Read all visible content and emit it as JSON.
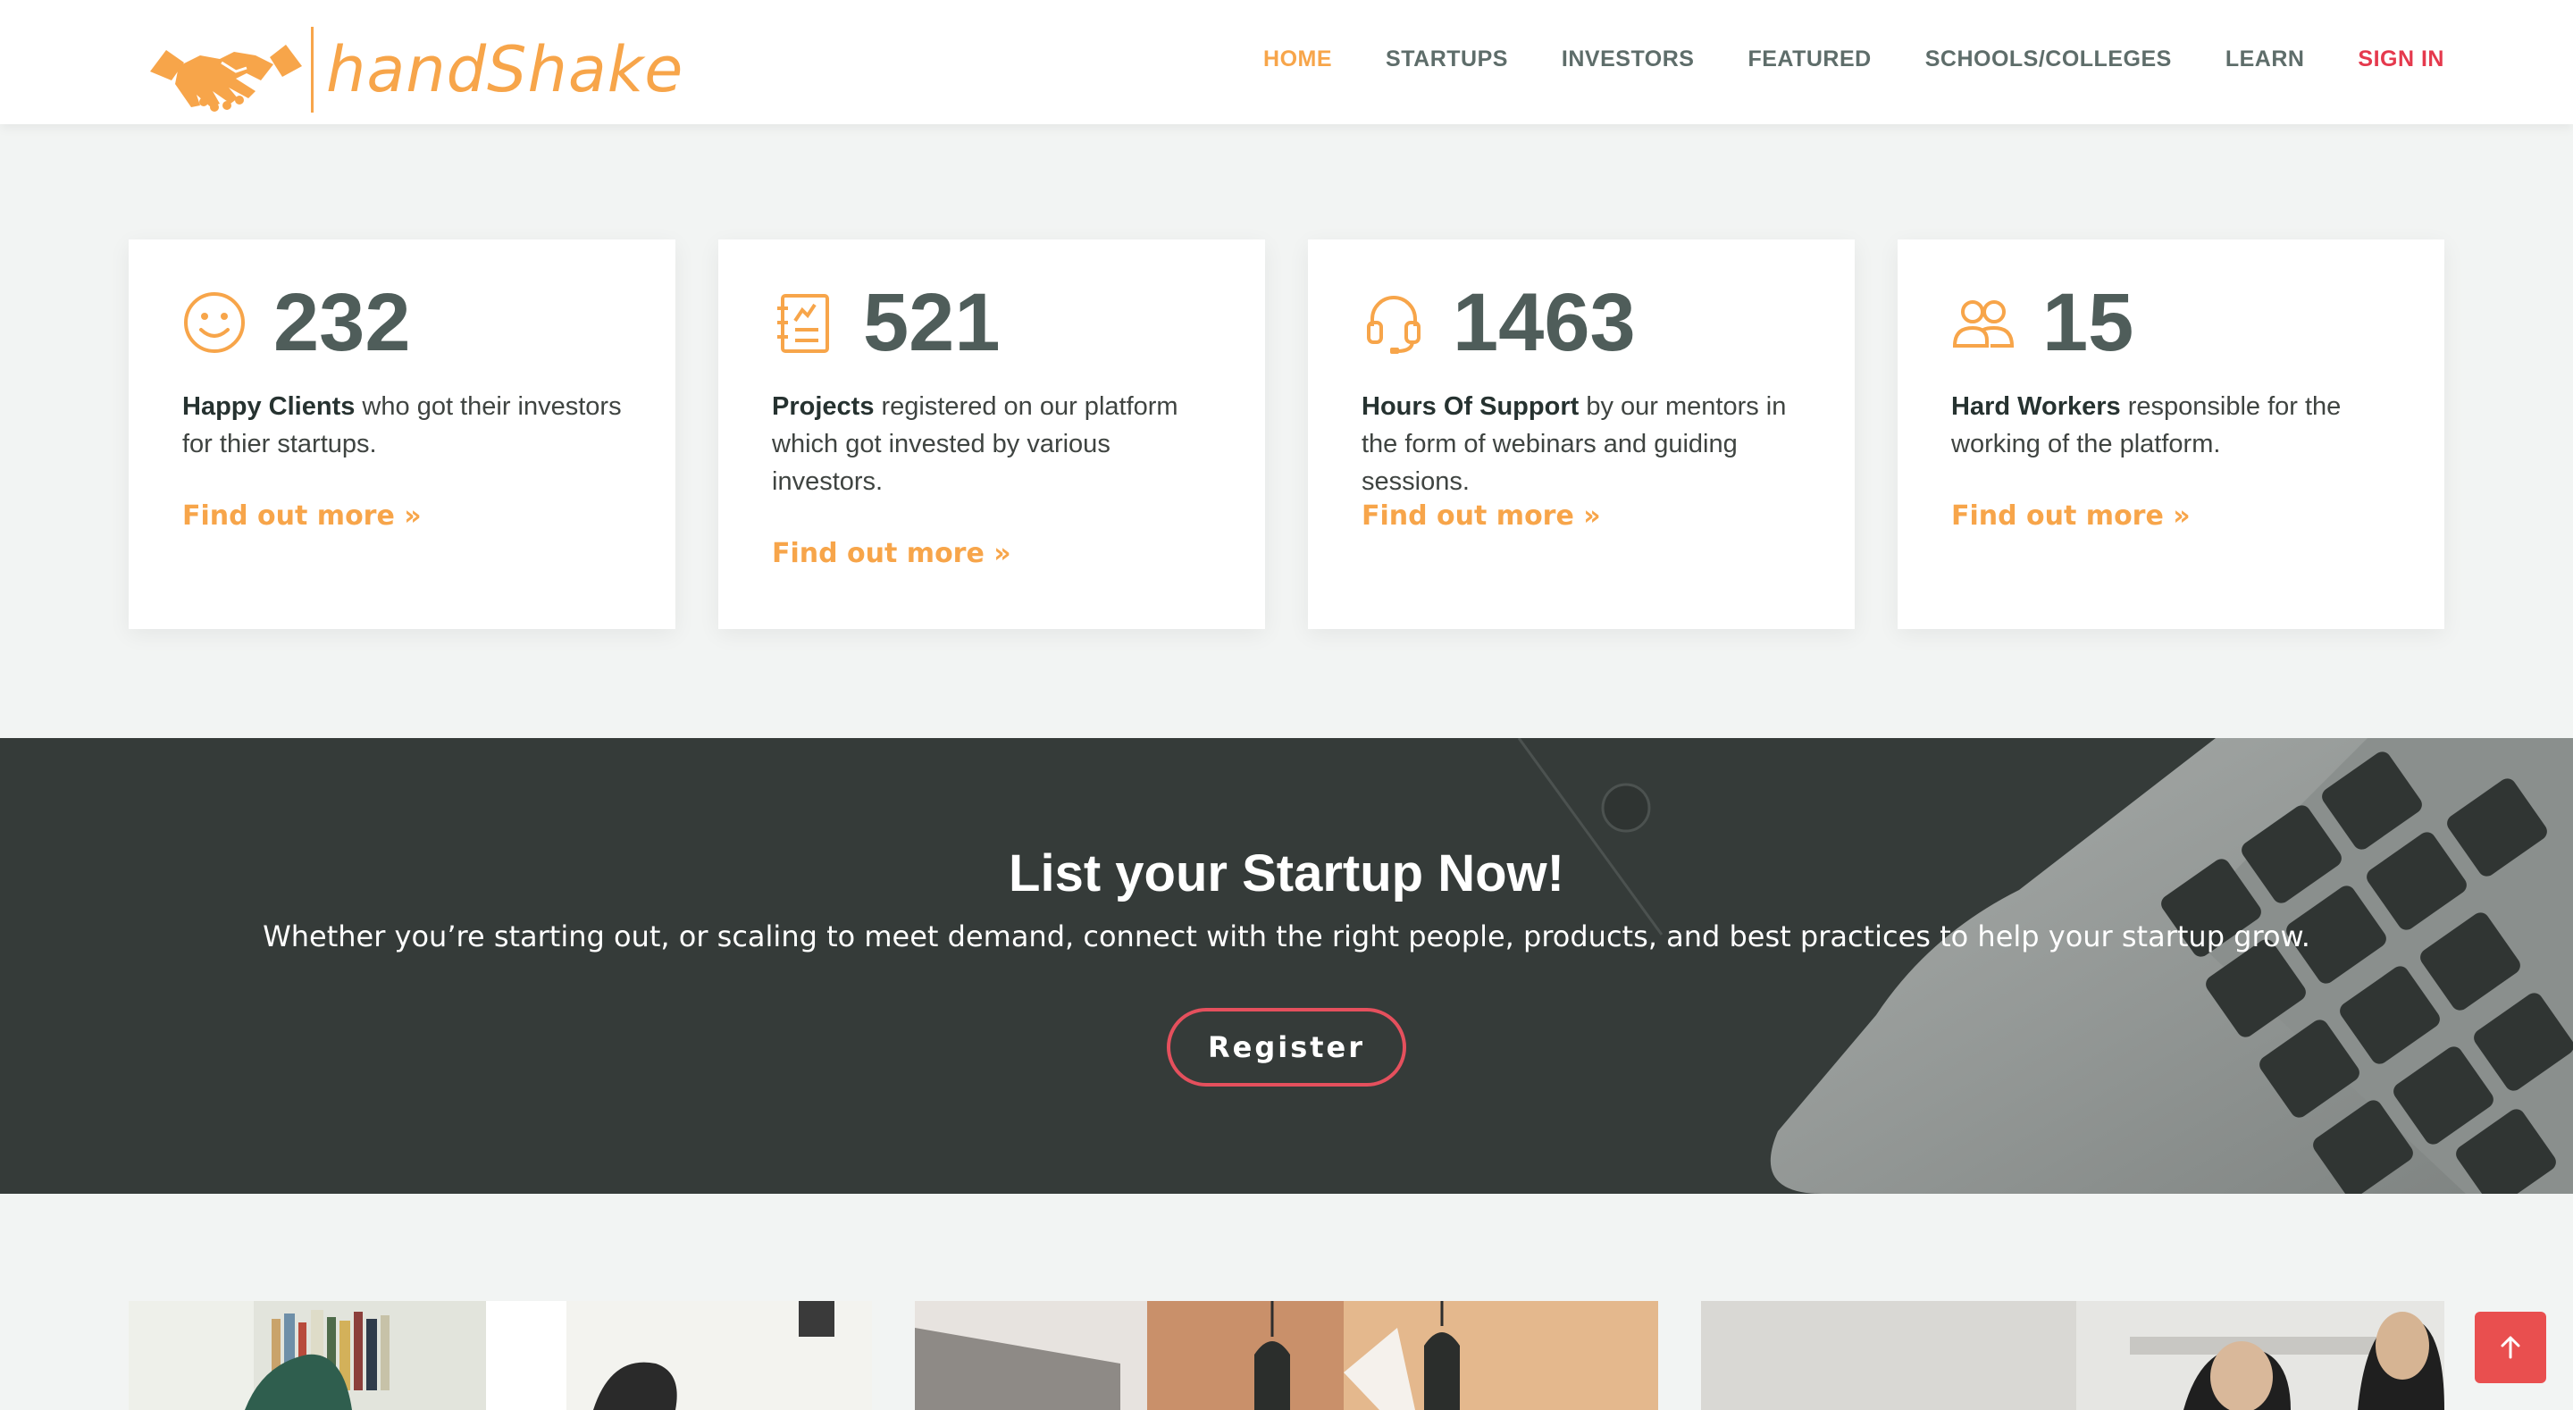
{
  "brand": {
    "name": "handShake",
    "accent": "#f7a54a",
    "icon": "handshake-icon"
  },
  "nav": {
    "items": [
      {
        "label": "HOME",
        "active": true
      },
      {
        "label": "STARTUPS"
      },
      {
        "label": "INVESTORS"
      },
      {
        "label": "FEATURED"
      },
      {
        "label": "SCHOOLS/COLLEGES"
      },
      {
        "label": "LEARN"
      },
      {
        "label": "SIGN IN",
        "color": "#e5394d"
      }
    ]
  },
  "stats": [
    {
      "icon": "smiley-icon",
      "number": "232",
      "bold": "Happy Clients",
      "rest": " who got their investors for thier startups.",
      "link": "Find out more »"
    },
    {
      "icon": "clipboard-icon",
      "number": "521",
      "bold": "Projects",
      "rest": " registered on our platform which got invested by various investors.",
      "link": "Find out more »"
    },
    {
      "icon": "headset-icon",
      "number": "1463",
      "bold": "Hours Of Support",
      "rest": " by our mentors in the form of webinars and guiding sessions.",
      "link": "Find out more »"
    },
    {
      "icon": "users-icon",
      "number": "15",
      "bold": "Hard Workers",
      "rest": " responsible for the working of the platform.",
      "link": "Find out more »"
    }
  ],
  "cta": {
    "title": "List your Startup Now!",
    "subtitle": "Whether you’re starting out, or scaling to meet demand, connect with the right people, products, and best practices to help your startup grow.",
    "button": "Register",
    "button_color": "#e5505d"
  },
  "scroll_top": {
    "icon": "arrow-up-icon",
    "color": "#e94f4f"
  }
}
